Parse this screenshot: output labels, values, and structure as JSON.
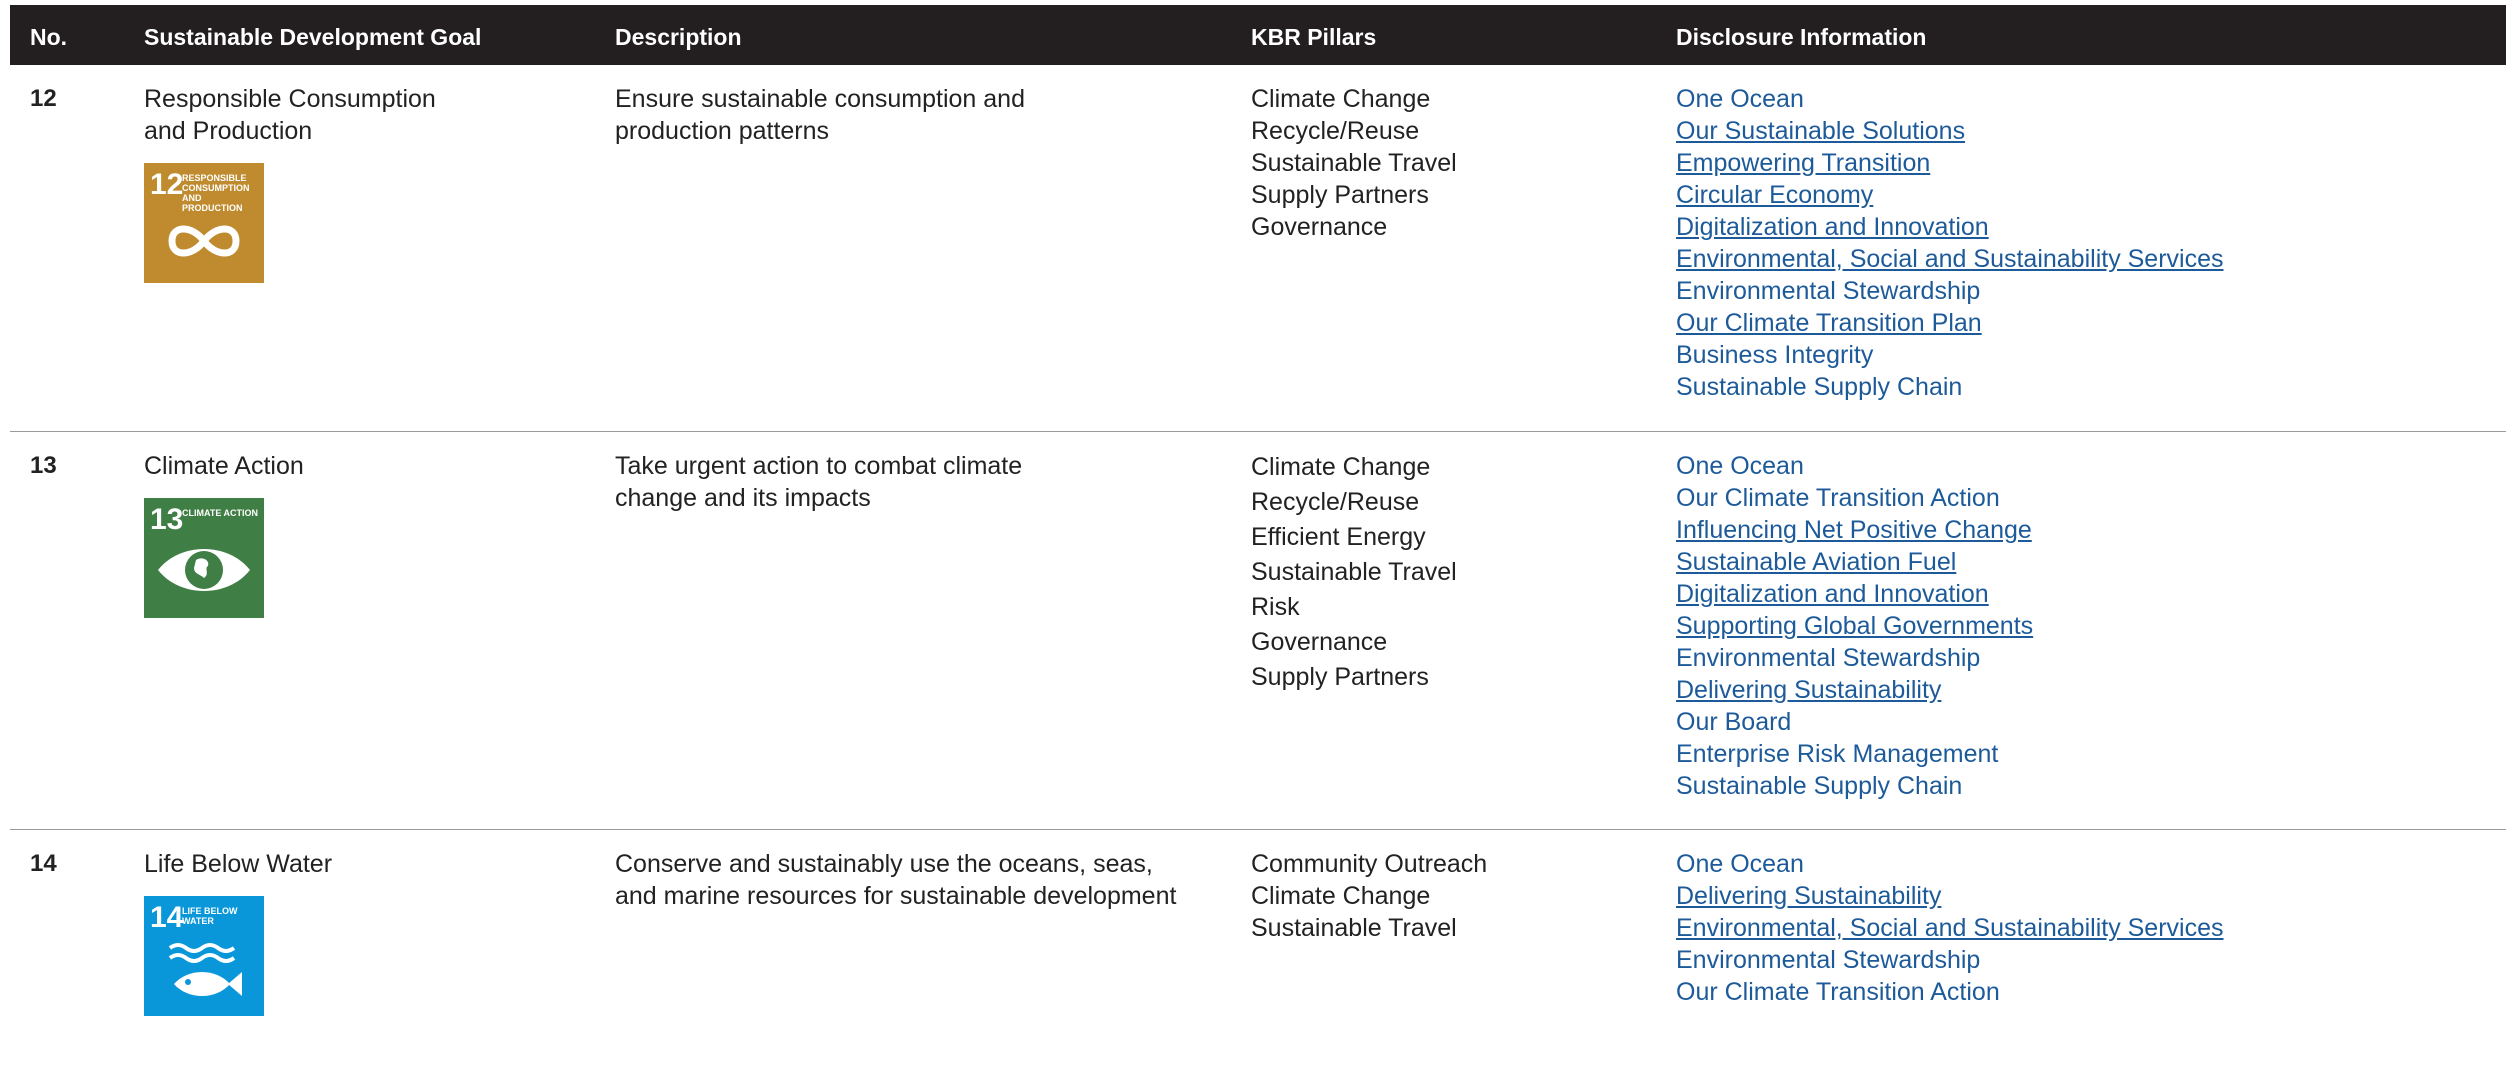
{
  "header": {
    "no": "No.",
    "goal": "Sustainable Development Goal",
    "description": "Description",
    "pillars": "KBR Pillars",
    "disclosure": "Disclosure Information"
  },
  "rows": [
    {
      "no": "12",
      "goal_line1": "Responsible Consumption",
      "goal_line2": "and Production",
      "description_line1": "Ensure sustainable consumption and",
      "description_line2": "production patterns",
      "icon": {
        "name": "responsible-consumption-icon",
        "number": "12",
        "label": "RESPONSIBLE CONSUMPTION AND PRODUCTION",
        "color": "#bf8b2e"
      },
      "pillars": [
        "Climate Change",
        "Recycle/Reuse",
        "Sustainable Travel",
        "Supply Partners",
        "Governance"
      ],
      "links": [
        {
          "text": "One Ocean",
          "underline": false
        },
        {
          "text": "Our Sustainable Solutions",
          "underline": true
        },
        {
          "text": "Empowering Transition",
          "underline": true
        },
        {
          "text": "Circular Economy",
          "underline": true
        },
        {
          "text": "Digitalization and Innovation",
          "underline": true
        },
        {
          "text": "Environmental, Social and Sustainability Services",
          "underline": true
        },
        {
          "text": "Environmental Stewardship",
          "underline": false
        },
        {
          "text": "Our Climate Transition Plan",
          "underline": true
        },
        {
          "text": "Business Integrity",
          "underline": false
        },
        {
          "text": "Sustainable Supply Chain",
          "underline": false
        }
      ]
    },
    {
      "no": "13",
      "goal_line1": "Climate Action",
      "goal_line2": "",
      "description_line1": "Take urgent action to combat climate",
      "description_line2": "change and its impacts",
      "icon": {
        "name": "climate-action-icon",
        "number": "13",
        "label": "CLIMATE ACTION",
        "color": "#3f7e44"
      },
      "pillars": [
        "Climate Change",
        "Recycle/Reuse",
        "Efficient Energy",
        "Sustainable Travel",
        "Risk",
        "Governance",
        "Supply Partners"
      ],
      "links": [
        {
          "text": "One Ocean",
          "underline": false
        },
        {
          "text": "Our Climate Transition Action",
          "underline": false
        },
        {
          "text": "Influencing Net Positive Change",
          "underline": true
        },
        {
          "text": "Sustainable Aviation Fuel ",
          "underline": true
        },
        {
          "text": "Digitalization and Innovation",
          "underline": true
        },
        {
          "text": "Supporting Global Governments",
          "underline": true
        },
        {
          "text": "Environmental Stewardship",
          "underline": false
        },
        {
          "text": "Delivering Sustainability",
          "underline": true
        },
        {
          "text": "Our Board",
          "underline": false
        },
        {
          "text": "Enterprise Risk Management",
          "underline": false
        },
        {
          "text": "Sustainable Supply Chain",
          "underline": false
        }
      ]
    },
    {
      "no": "14",
      "goal_line1": "Life Below Water",
      "goal_line2": "",
      "description_line1": "Conserve and sustainably use the oceans, seas,",
      "description_line2": "and marine resources for sustainable development",
      "icon": {
        "name": "life-below-water-icon",
        "number": "14",
        "label": "LIFE BELOW WATER",
        "color": "#0a97d9"
      },
      "pillars": [
        "Community Outreach",
        "Climate Change",
        "Sustainable Travel"
      ],
      "links": [
        {
          "text": "One Ocean",
          "underline": false
        },
        {
          "text": "Delivering Sustainability",
          "underline": true
        },
        {
          "text": "Environmental, Social and Sustainability Services",
          "underline": true
        },
        {
          "text": "Environmental Stewardship",
          "underline": false
        },
        {
          "text": "Our Climate Transition Action",
          "underline": false
        }
      ]
    }
  ]
}
